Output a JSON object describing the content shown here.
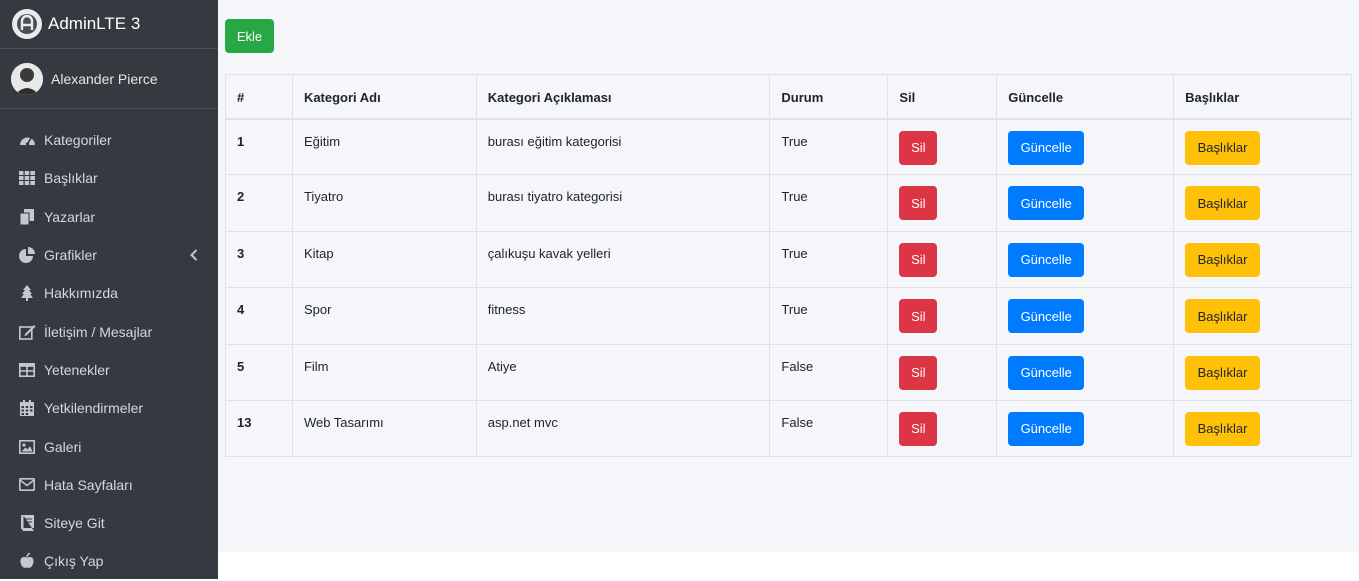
{
  "brand": {
    "title": "AdminLTE 3"
  },
  "user": {
    "name": "Alexander Pierce"
  },
  "sidebar": {
    "items": [
      {
        "label": "Kategoriler",
        "icon": "tachometer-icon"
      },
      {
        "label": "Başlıklar",
        "icon": "grid-icon"
      },
      {
        "label": "Yazarlar",
        "icon": "copy-icon"
      },
      {
        "label": "Grafikler",
        "icon": "pie-chart-icon",
        "has_arrow": true
      },
      {
        "label": "Hakkımızda",
        "icon": "tree-icon"
      },
      {
        "label": "İletişim / Mesajlar",
        "icon": "edit-icon"
      },
      {
        "label": "Yetenekler",
        "icon": "columns-icon"
      },
      {
        "label": "Yetkilendirmeler",
        "icon": "calendar-icon"
      },
      {
        "label": "Galeri",
        "icon": "image-icon"
      },
      {
        "label": "Hata Sayfaları",
        "icon": "envelope-icon"
      },
      {
        "label": "Siteye Git",
        "icon": "book-icon"
      },
      {
        "label": "Çıkış Yap",
        "icon": "apple-icon"
      }
    ]
  },
  "toolbar": {
    "add_label": "Ekle"
  },
  "table": {
    "headers": [
      "#",
      "Kategori Adı",
      "Kategori Açıklaması",
      "Durum",
      "Sil",
      "Güncelle",
      "Başlıklar"
    ],
    "rows": [
      {
        "id": "1",
        "name": "Eğitim",
        "desc": "burası eğitim kategorisi",
        "status": "True"
      },
      {
        "id": "2",
        "name": "Tiyatro",
        "desc": "burası tiyatro kategorisi",
        "status": "True"
      },
      {
        "id": "3",
        "name": "Kitap",
        "desc": "çalıkuşu kavak yelleri",
        "status": "True"
      },
      {
        "id": "4",
        "name": "Spor",
        "desc": "fitness",
        "status": "True"
      },
      {
        "id": "5",
        "name": "Film",
        "desc": "Atiye",
        "status": "False"
      },
      {
        "id": "13",
        "name": "Web Tasarımı",
        "desc": "asp.net mvc",
        "status": "False"
      }
    ],
    "delete_label": "Sil",
    "update_label": "Güncelle",
    "headings_label": "Başlıklar"
  },
  "colors": {
    "sidebar_bg": "#343a40",
    "content_bg": "#f4f6f9",
    "success": "#28a745",
    "danger": "#dc3545",
    "primary": "#007bff",
    "warning": "#ffc107"
  }
}
